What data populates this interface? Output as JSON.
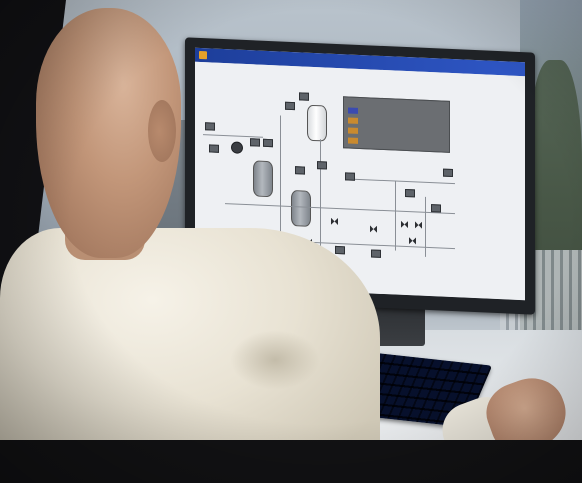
{
  "scene": {
    "subject": "person-at-workstation",
    "screen": {
      "window_title": "",
      "legend_rows": [
        {
          "color": "#3b4bb0",
          "label": ""
        },
        {
          "color": "#c98a2f",
          "label": ""
        },
        {
          "color": "#c98a2f",
          "label": ""
        },
        {
          "color": "#c98a2f",
          "label": ""
        }
      ]
    }
  },
  "colors": {
    "titlebar": "#2f57c6",
    "screen_bg": "#eef0f3",
    "legend_panel": "#6b6e72",
    "keyboard": "#1c2b4a",
    "shirt": "#e8e2d3"
  }
}
